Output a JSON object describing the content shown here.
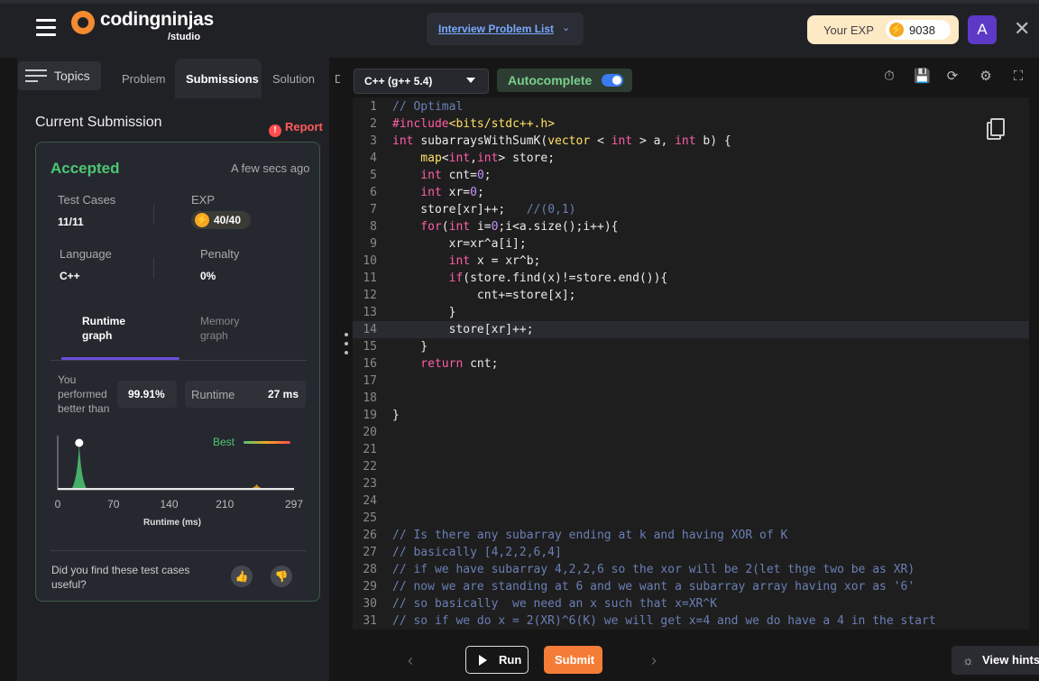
{
  "header": {
    "logo_text": "codingninjas",
    "logo_sub": "/studio",
    "problem_list_link": "Interview Problem List",
    "exp_label": "Your EXP",
    "exp_value": "9038",
    "avatar_letter": "A",
    "close_glyph": "✕"
  },
  "tabs": {
    "topics": "Topics",
    "problem": "Problem",
    "submissions": "Submissions",
    "solution": "Solution",
    "discuss_cut": "D"
  },
  "submission": {
    "title": "Current Submission",
    "report": "Report",
    "status": "Accepted",
    "time_ago": "A few secs ago",
    "test_cases_label": "Test Cases",
    "test_cases_value": "11/11",
    "exp_label": "EXP",
    "exp_value": "40/40",
    "language_label": "Language",
    "language_value": "C++",
    "penalty_label": "Penalty",
    "penalty_value": "0%",
    "runtime_graph_tab": "Runtime graph",
    "memory_graph_tab": "Memory graph",
    "performed_label": "You performed better than",
    "performed_value": "99.91%",
    "runtime_label": "Runtime",
    "runtime_value": "27 ms",
    "best_label": "Best",
    "useful_question": "Did you find these test cases useful?",
    "accent_color": "#4cc772",
    "report_color": "#ff5c5c"
  },
  "chart_data": {
    "type": "area",
    "xlabel": "Runtime (ms)",
    "x_ticks": [
      "0",
      "70",
      "140",
      "210",
      "297"
    ],
    "xlim": [
      0,
      297
    ],
    "series": [
      {
        "name": "",
        "color": "#4cc772",
        "peak_x": 27,
        "peak_relative_height": 1.0
      },
      {
        "name": "",
        "color": "#f5a623",
        "peak_x": 250,
        "peak_relative_height": 0.12
      }
    ],
    "marker_x": 27,
    "legend": "top-right"
  },
  "editor": {
    "language": "C++ (g++ 5.4)",
    "autocomplete_label": "Autocomplete",
    "autocomplete_on": true,
    "highlighted_line": 14,
    "lines": [
      [
        {
          "t": "// Optimal",
          "c": "#6a7fb5"
        }
      ],
      [
        {
          "t": "#include",
          "c": "#ff5ea8"
        },
        {
          "t": "<bits/stdc++.h>",
          "c": "#ffe066"
        }
      ],
      [
        {
          "t": "int ",
          "c": "#ff5ea8"
        },
        {
          "t": "subarraysWithSumK",
          "c": "#eaeaea"
        },
        {
          "t": "(",
          "c": "#eaeaea"
        },
        {
          "t": "vector ",
          "c": "#ffe066"
        },
        {
          "t": "< ",
          "c": "#eaeaea"
        },
        {
          "t": "int ",
          "c": "#ff5ea8"
        },
        {
          "t": "> a, ",
          "c": "#eaeaea"
        },
        {
          "t": "int ",
          "c": "#ff5ea8"
        },
        {
          "t": "b) {",
          "c": "#eaeaea"
        }
      ],
      [
        {
          "t": "    map",
          "c": "#ffe066"
        },
        {
          "t": "<",
          "c": "#eaeaea"
        },
        {
          "t": "int",
          "c": "#ff5ea8"
        },
        {
          "t": ",",
          "c": "#eaeaea"
        },
        {
          "t": "int",
          "c": "#ff5ea8"
        },
        {
          "t": "> store;",
          "c": "#eaeaea"
        }
      ],
      [
        {
          "t": "    int ",
          "c": "#ff5ea8"
        },
        {
          "t": "cnt=",
          "c": "#eaeaea"
        },
        {
          "t": "0",
          "c": "#c490ff"
        },
        {
          "t": ";",
          "c": "#eaeaea"
        }
      ],
      [
        {
          "t": "    int ",
          "c": "#ff5ea8"
        },
        {
          "t": "xr=",
          "c": "#eaeaea"
        },
        {
          "t": "0",
          "c": "#c490ff"
        },
        {
          "t": ";",
          "c": "#eaeaea"
        }
      ],
      [
        {
          "t": "    store[xr]++;   ",
          "c": "#eaeaea"
        },
        {
          "t": "//(0,1)",
          "c": "#6a7fb5"
        }
      ],
      [
        {
          "t": "    for",
          "c": "#ff5ea8"
        },
        {
          "t": "(",
          "c": "#eaeaea"
        },
        {
          "t": "int ",
          "c": "#ff5ea8"
        },
        {
          "t": "i=",
          "c": "#eaeaea"
        },
        {
          "t": "0",
          "c": "#c490ff"
        },
        {
          "t": ";i<a.size();i++){",
          "c": "#eaeaea"
        }
      ],
      [
        {
          "t": "        xr=xr^a[i];",
          "c": "#eaeaea"
        }
      ],
      [
        {
          "t": "        int ",
          "c": "#ff5ea8"
        },
        {
          "t": "x = xr^b;",
          "c": "#eaeaea"
        }
      ],
      [
        {
          "t": "        if",
          "c": "#ff5ea8"
        },
        {
          "t": "(store.find(x)!=store.end()){",
          "c": "#eaeaea"
        }
      ],
      [
        {
          "t": "            cnt+=store[x];",
          "c": "#eaeaea"
        }
      ],
      [
        {
          "t": "        }",
          "c": "#eaeaea"
        }
      ],
      [
        {
          "t": "        store[xr]++;",
          "c": "#eaeaea"
        }
      ],
      [
        {
          "t": "    }",
          "c": "#eaeaea"
        }
      ],
      [
        {
          "t": "    return ",
          "c": "#ff5ea8"
        },
        {
          "t": "cnt;",
          "c": "#eaeaea"
        }
      ],
      [],
      [],
      [
        {
          "t": "}",
          "c": "#eaeaea"
        }
      ],
      [],
      [],
      [],
      [],
      [],
      [],
      [
        {
          "t": "// Is there any subarray ending at k and having XOR of K",
          "c": "#6a7fb5"
        }
      ],
      [
        {
          "t": "// basically [4,2,2,6,4]",
          "c": "#6a7fb5"
        }
      ],
      [
        {
          "t": "// if we have subarray 4,2,2,6 so the xor will be 2(let thge two be as XR)",
          "c": "#6a7fb5"
        }
      ],
      [
        {
          "t": "// now we are standing at 6 and we want a subarray array having xor as '6'",
          "c": "#6a7fb5"
        }
      ],
      [
        {
          "t": "// so basically  we need an x such that x=XR^K",
          "c": "#6a7fb5"
        }
      ],
      [
        {
          "t": "// so if we do x = 2(XR)^6(K) we will get x=4 and we do have a 4 in the start",
          "c": "#6a7fb5"
        }
      ]
    ]
  },
  "bottom": {
    "run": "Run",
    "submit": "Submit",
    "view_hints": "View hints",
    "prev_glyph": "‹",
    "next_glyph": "›"
  }
}
